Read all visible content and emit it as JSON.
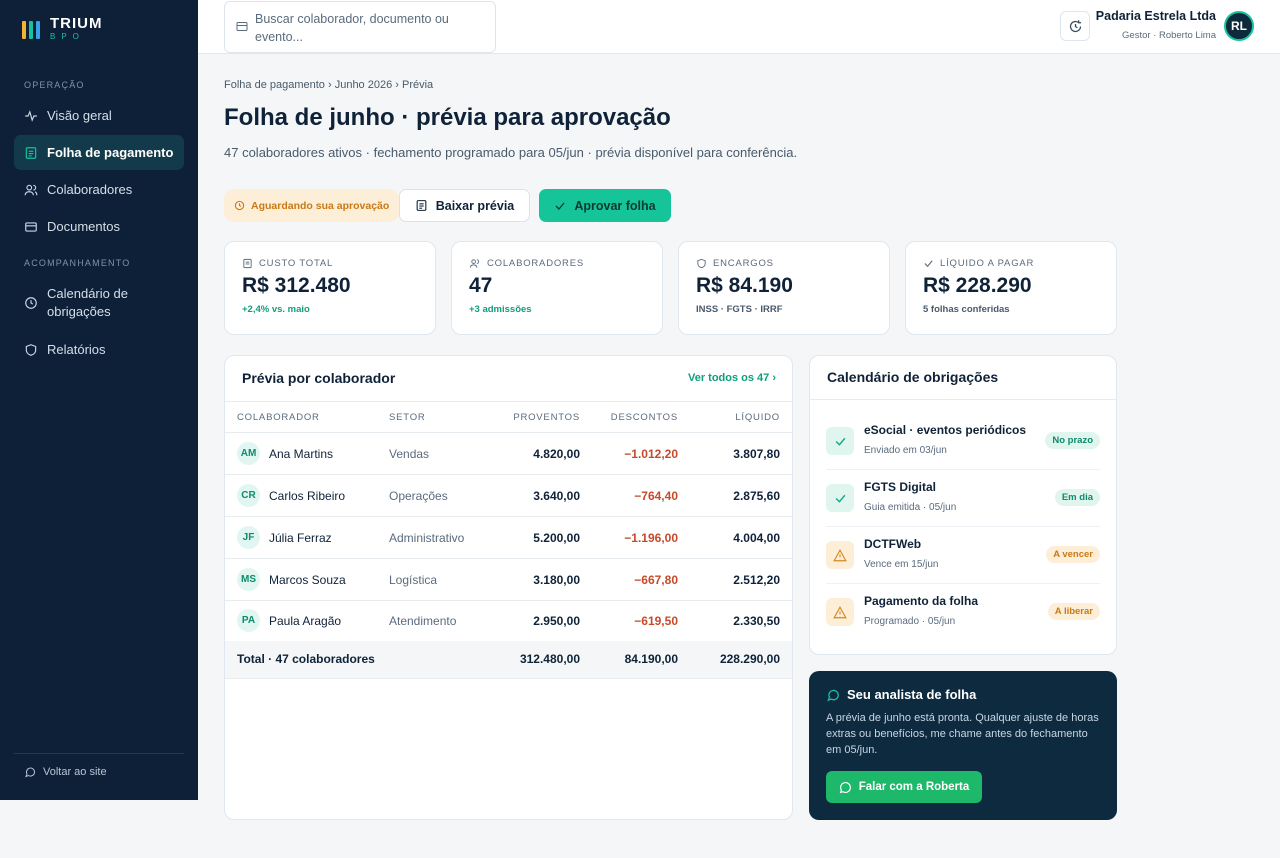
{
  "brand": {
    "name": "TRIUM",
    "sub": "BPO",
    "colors": [
      "#f2b233",
      "#18c29c",
      "#3aa0e8"
    ]
  },
  "sidebar": {
    "section_operacao": "OPERAÇÃO",
    "section_acompanhamento": "ACOMPANHAMENTO",
    "items": [
      {
        "label": "Visão geral",
        "icon": "activity-icon"
      },
      {
        "label": "Folha de pagamento",
        "icon": "document-list-icon",
        "active": true
      },
      {
        "label": "Colaboradores",
        "icon": "users-icon"
      },
      {
        "label": "Documentos",
        "icon": "card-icon"
      },
      {
        "label": "Calendário de obrigações",
        "icon": "clock-icon"
      },
      {
        "label": "Relatórios",
        "icon": "shield-icon"
      }
    ],
    "back_label": "Voltar ao site"
  },
  "topbar": {
    "search_placeholder": "Buscar colaborador, documento ou evento...",
    "company_name": "Padaria Estrela Ltda",
    "company_user": "Gestor · Roberto Lima",
    "avatar_initials": "RL"
  },
  "main": {
    "breadcrumb": [
      "Folha de pagamento",
      "Junho 2026",
      "Prévia"
    ],
    "title": "Folha de junho · prévia para aprovação",
    "subtitle": "47 colaboradores ativos · fechamento programado para 05/jun · prévia disponível para conferência.",
    "status": "Aguardando sua aprovação",
    "download_label": "Baixar prévia",
    "approve_label": "Aprovar folha"
  },
  "kpis": [
    {
      "label": "CUSTO TOTAL",
      "value": "R$ 312.480",
      "note": "+2,4% vs. maio",
      "note_color": "#0f9e7c"
    },
    {
      "label": "COLABORADORES",
      "value": "47",
      "note": "+3 admissões",
      "note_color": "#0f9e7c"
    },
    {
      "label": "ENCARGOS",
      "value": "R$ 84.190",
      "note": "INSS · FGTS · IRRF",
      "note_color": "#4a5a6b"
    },
    {
      "label": "LÍQUIDO A PAGAR",
      "value": "R$ 228.290",
      "note": "5 folhas conferidas",
      "note_color": "#4a5a6b"
    }
  ],
  "employees": {
    "title": "Prévia por colaborador",
    "see_all": "Ver todos os 47 ›",
    "columns": [
      "COLABORADOR",
      "SETOR",
      "PROVENTOS",
      "DESCONTOS",
      "LÍQUIDO"
    ],
    "rows": [
      {
        "initials": "AM",
        "name": "Ana Martins",
        "sector": "Vendas",
        "earnings": "4.820,00",
        "discounts": "−1.012,20",
        "net": "3.807,80"
      },
      {
        "initials": "CR",
        "name": "Carlos Ribeiro",
        "sector": "Operações",
        "earnings": "3.640,00",
        "discounts": "−764,40",
        "net": "2.875,60"
      },
      {
        "initials": "JF",
        "name": "Júlia Ferraz",
        "sector": "Administrativo",
        "earnings": "5.200,00",
        "discounts": "−1.196,00",
        "net": "4.004,00"
      },
      {
        "initials": "MS",
        "name": "Marcos Souza",
        "sector": "Logística",
        "earnings": "3.180,00",
        "discounts": "−667,80",
        "net": "2.512,20"
      },
      {
        "initials": "PA",
        "name": "Paula Aragão",
        "sector": "Atendimento",
        "earnings": "2.950,00",
        "discounts": "−619,50",
        "net": "2.330,50"
      }
    ],
    "total": {
      "label": "Total · 47 colaboradores",
      "earnings": "312.480,00",
      "discounts": "84.190,00",
      "net": "228.290,00"
    }
  },
  "calendar": {
    "title": "Calendário de obrigações",
    "items": [
      {
        "name": "eSocial · eventos periódicos",
        "meta": "Enviado em 03/jun",
        "badge": "No prazo",
        "kind": "ok"
      },
      {
        "name": "FGTS Digital",
        "meta": "Guia emitida · 05/jun",
        "badge": "Em dia",
        "kind": "ok"
      },
      {
        "name": "DCTFWeb",
        "meta": "Vence em 15/jun",
        "badge": "A vencer",
        "kind": "warn"
      },
      {
        "name": "Pagamento da folha",
        "meta": "Programado · 05/jun",
        "badge": "A liberar",
        "kind": "warn"
      }
    ]
  },
  "analyst": {
    "title": "Seu analista de folha",
    "text": "A prévia de junho está pronta. Qualquer ajuste de horas extras ou benefícios, me chame antes do fechamento em 05/jun.",
    "button": "Falar com a Roberta"
  }
}
